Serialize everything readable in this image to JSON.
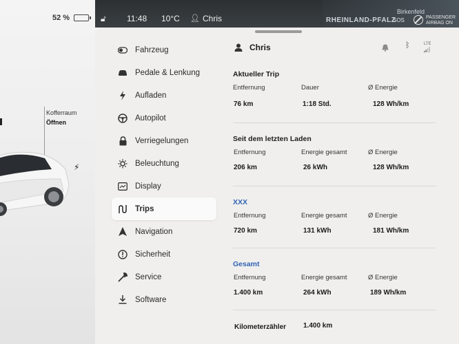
{
  "status": {
    "battery_percent": "52 %",
    "time": "11:48",
    "temperature": "10°C",
    "user": "Chris",
    "map_region": "RHEINLAND-PFALZ",
    "map_town": "Birkenfeld",
    "sos": "SOS",
    "airbag_line1": "PASSENGER",
    "airbag_line2": "AIRBAG ON"
  },
  "car": {
    "trunk_label": "Kofferraum",
    "trunk_action": "Öffnen"
  },
  "menu": [
    {
      "label": "Fahrzeug",
      "icon": "toggle-icon"
    },
    {
      "label": "Pedale & Lenkung",
      "icon": "car-icon"
    },
    {
      "label": "Aufladen",
      "icon": "bolt-icon"
    },
    {
      "label": "Autopilot",
      "icon": "steering-wheel-icon"
    },
    {
      "label": "Verriegelungen",
      "icon": "lock-icon"
    },
    {
      "label": "Beleuchtung",
      "icon": "sun-icon"
    },
    {
      "label": "Display",
      "icon": "display-icon"
    },
    {
      "label": "Trips",
      "icon": "trips-icon",
      "active": true
    },
    {
      "label": "Navigation",
      "icon": "navigation-icon"
    },
    {
      "label": "Sicherheit",
      "icon": "info-icon"
    },
    {
      "label": "Service",
      "icon": "wrench-icon"
    },
    {
      "label": "Software",
      "icon": "download-icon"
    }
  ],
  "profile": {
    "name": "Chris",
    "lte": "LTE"
  },
  "trips": {
    "current": {
      "title": "Aktueller Trip",
      "h1": "Entfernung",
      "h2": "Dauer",
      "h3": "Ø Energie",
      "v1": "76 km",
      "v2": "1:18 Std.",
      "v3": "128 Wh/km"
    },
    "since_charge": {
      "title": "Seit dem letzten Laden",
      "h1": "Entfernung",
      "h2": "Energie gesamt",
      "h3": "Ø Energie",
      "v1": "206 km",
      "v2": "26 kWh",
      "v3": "128 Wh/km"
    },
    "xxx": {
      "title": "XXX",
      "h1": "Entfernung",
      "h2": "Energie gesamt",
      "h3": "Ø Energie",
      "v1": "720 km",
      "v2": "131 kWh",
      "v3": "181 Wh/km"
    },
    "total": {
      "title": "Gesamt",
      "h1": "Entfernung",
      "h2": "Energie gesamt",
      "h3": "Ø Energie",
      "v1": "1.400 km",
      "v2": "264 kWh",
      "v3": "189 Wh/km"
    },
    "odometer": {
      "label": "Kilometerzähler",
      "value": "1.400 km"
    }
  },
  "colors": {
    "accent_blue": "#3264b4",
    "panel_bg": "#f0efee",
    "statusbar_bg": "#2c3033"
  }
}
